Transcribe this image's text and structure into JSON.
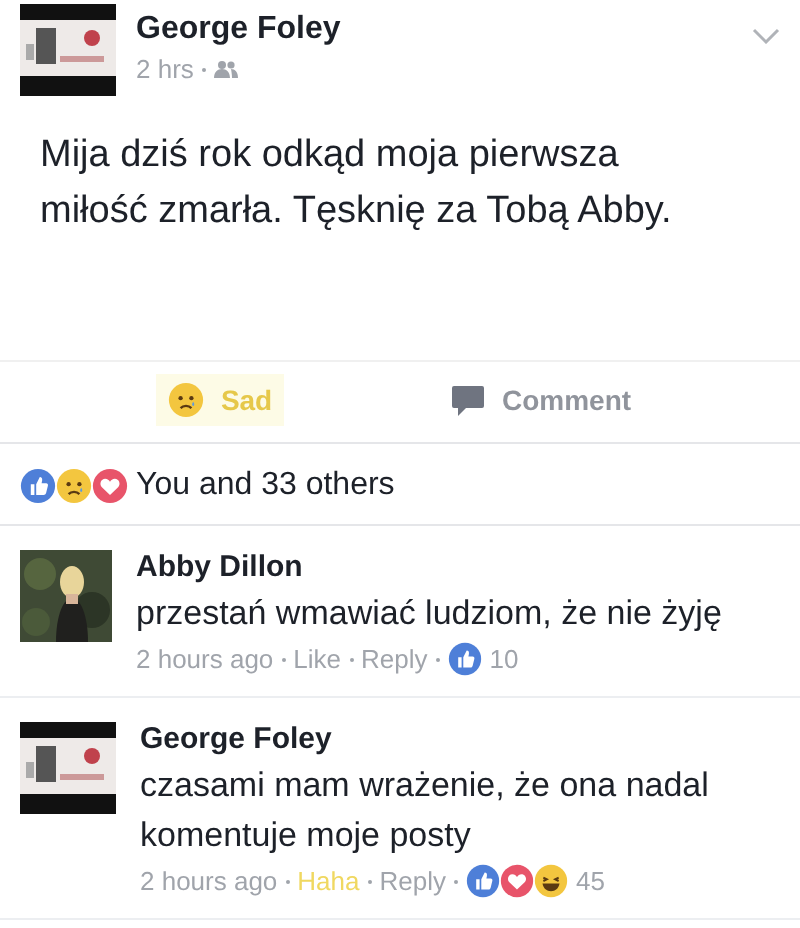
{
  "post": {
    "author": "George Foley",
    "time": "2 hrs",
    "text": "Mija dziś rok odkąd moja pierwsza miłość zmarła. Tęsknię za Tobą Abby.",
    "actions": [
      {
        "kind": "sad",
        "label": "Sad",
        "selected": true
      },
      {
        "kind": "comment",
        "label": "Comment",
        "selected": false
      }
    ]
  },
  "summary": {
    "icons": [
      {
        "kind": "like"
      },
      {
        "kind": "sad"
      },
      {
        "kind": "love"
      }
    ],
    "text": "You and 33 others"
  },
  "comments": [
    {
      "author": "Abby Dillon",
      "text": "przestań wmawiać ludziom, że nie żyję",
      "time": "2 hours ago",
      "reaction": {
        "label": "Like",
        "selected": false
      },
      "reply": "Reply",
      "icons": [
        {
          "kind": "like"
        }
      ],
      "count": "10"
    },
    {
      "author": "George Foley",
      "text": "czasami mam wrażenie, że ona nadal komentuje moje posty",
      "time": "2 hours ago",
      "reaction": {
        "label": "Haha",
        "selected": true
      },
      "reply": "Reply",
      "icons": [
        {
          "kind": "like"
        },
        {
          "kind": "love"
        },
        {
          "kind": "haha"
        }
      ],
      "count": "45"
    }
  ]
}
